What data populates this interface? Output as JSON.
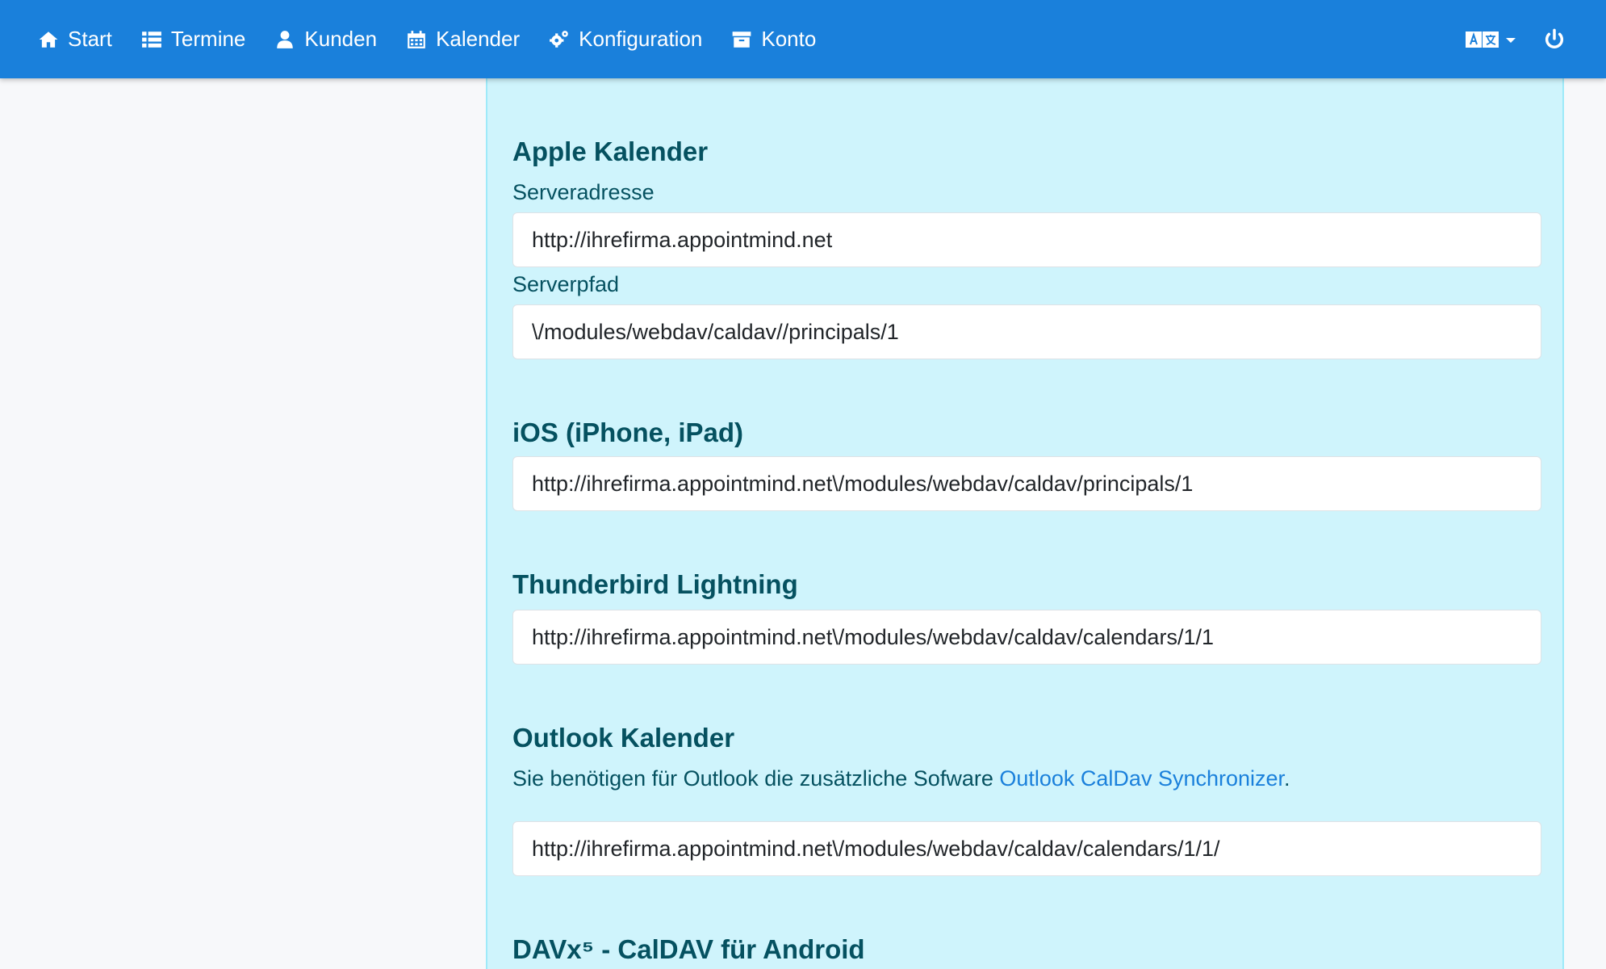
{
  "nav": {
    "items": [
      {
        "label": "Start",
        "icon": "home-icon"
      },
      {
        "label": "Termine",
        "icon": "list-icon"
      },
      {
        "label": "Kunden",
        "icon": "user-icon"
      },
      {
        "label": "Kalender",
        "icon": "calendar-icon"
      },
      {
        "label": "Konfiguration",
        "icon": "gears-icon"
      },
      {
        "label": "Konto",
        "icon": "archive-icon"
      }
    ],
    "brand_color": "#1a80db"
  },
  "apple": {
    "title": "Apple Kalender",
    "server_label": "Serveradresse",
    "server_value": "http://ihrefirma.appointmind.net",
    "path_label": "Serverpfad",
    "path_value": "\\/modules/webdav/caldav//principals/1"
  },
  "ios": {
    "title": "iOS (iPhone, iPad)",
    "value": "http://ihrefirma.appointmind.net\\/modules/webdav/caldav/principals/1"
  },
  "thunderbird": {
    "title": "Thunderbird Lightning",
    "value": "http://ihrefirma.appointmind.net\\/modules/webdav/caldav/calendars/1/1"
  },
  "outlook": {
    "title": "Outlook Kalender",
    "note_before": "Sie benötigen für Outlook die zusätzliche Sofware ",
    "note_link": "Outlook CalDav Synchronizer",
    "note_after": ".",
    "value": "http://ihrefirma.appointmind.net\\/modules/webdav/caldav/calendars/1/1/"
  },
  "davx": {
    "title": "DAVx⁵ - CalDAV für Android"
  }
}
